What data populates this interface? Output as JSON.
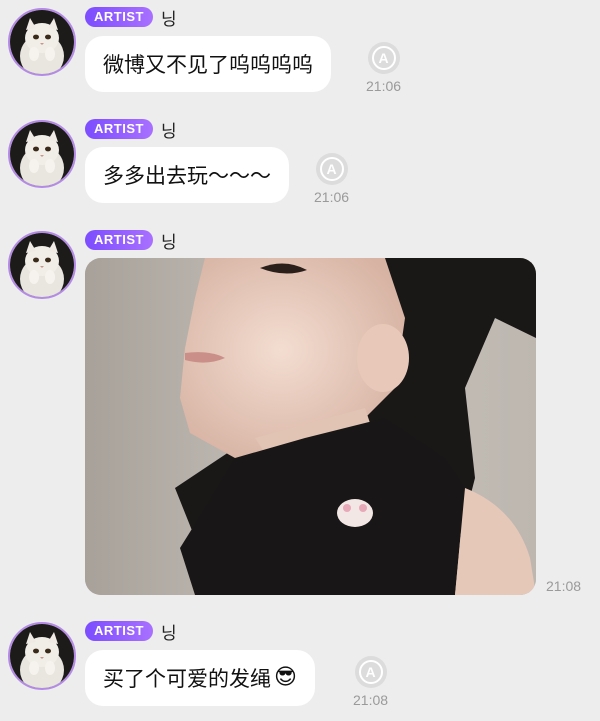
{
  "chat": {
    "messages": [
      {
        "badge": "ARTIST",
        "sender": "닝",
        "text": "微博又不见了呜呜呜呜",
        "read_icon_letter": "A",
        "time": "21:06"
      },
      {
        "badge": "ARTIST",
        "sender": "닝",
        "text": "多多出去玩～～～",
        "read_icon_letter": "A",
        "time": "21:06"
      },
      {
        "badge": "ARTIST",
        "sender": "닝",
        "type": "photo",
        "time": "21:08"
      },
      {
        "badge": "ARTIST",
        "sender": "닝",
        "text": "买了个可爱的发绳",
        "emoji": "😎",
        "read_icon_letter": "A",
        "time": "21:08"
      }
    ]
  },
  "icons": {
    "avatar": "white-cat-avatar",
    "read_receipt": "circled-a-icon",
    "emoji": "sunglasses-emoji"
  },
  "colors": {
    "background": "#ededed",
    "bubble": "#ffffff",
    "badge": "#8b5cf6",
    "avatar_ring": "#b48ae6",
    "timestamp": "#9a9a9a"
  }
}
